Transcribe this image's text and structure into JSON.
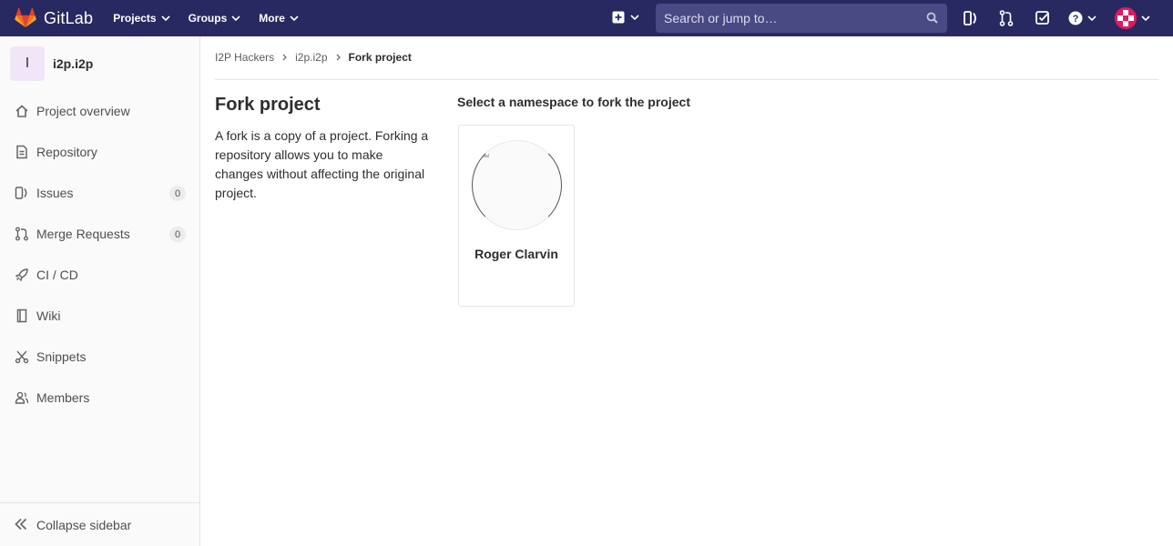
{
  "navbar": {
    "brand": "GitLab",
    "menu": [
      {
        "label": "Projects"
      },
      {
        "label": "Groups"
      },
      {
        "label": "More"
      }
    ],
    "search_placeholder": "Search or jump to…",
    "colors": {
      "bg": "#292961",
      "search_bg": "#494983"
    }
  },
  "sidebar": {
    "project_initial": "I",
    "project_name": "i2p.i2p",
    "items": [
      {
        "label": "Project overview",
        "icon": "home-icon"
      },
      {
        "label": "Repository",
        "icon": "doc-text-icon"
      },
      {
        "label": "Issues",
        "icon": "issues-icon",
        "badge": "0"
      },
      {
        "label": "Merge Requests",
        "icon": "git-merge-icon",
        "badge": "0"
      },
      {
        "label": "CI / CD",
        "icon": "rocket-icon"
      },
      {
        "label": "Wiki",
        "icon": "book-icon"
      },
      {
        "label": "Snippets",
        "icon": "snippet-icon"
      },
      {
        "label": "Members",
        "icon": "users-icon"
      }
    ],
    "collapse_label": "Collapse sidebar"
  },
  "breadcrumb": {
    "items": [
      "I2P Hackers",
      "i2p.i2p"
    ],
    "current": "Fork project"
  },
  "main": {
    "title": "Fork project",
    "description": "A fork is a copy of a project. Forking a repository allows you to make changes without affecting the original project.",
    "namespace_heading": "Select a namespace to fork the project",
    "namespaces": [
      {
        "name": "Roger Clarvin"
      }
    ]
  }
}
